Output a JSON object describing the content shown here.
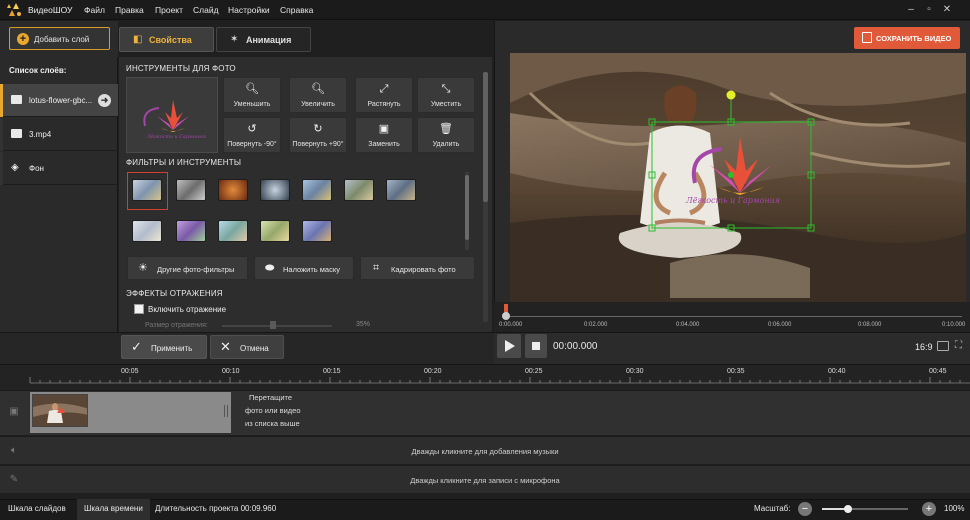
{
  "app": {
    "name": "ВидеоШОУ"
  },
  "menu": [
    "Файл",
    "Правка",
    "Проект",
    "Слайд",
    "Настройки",
    "Справка"
  ],
  "left": {
    "add_layer": "Добавить слой",
    "layers_title": "Список слоёв:"
  },
  "layers": [
    {
      "label": "lotus-flower-gbc...",
      "icon": "image-icon"
    },
    {
      "label": "3.mp4",
      "icon": "video-icon"
    },
    {
      "label": "Фон",
      "icon": "paint-bucket-icon"
    }
  ],
  "tabs": {
    "properties": "Свойства",
    "animation": "Анимация"
  },
  "photo_tools": {
    "title": "ИНСТРУМЕНТЫ ДЛЯ ФОТО",
    "buttons": [
      "Уменьшить",
      "Увеличить",
      "Растянуть",
      "Уместить",
      "Повернуть -90°",
      "Повернуть +90°",
      "Заменить",
      "Удалить"
    ],
    "watermark_text": "Лёгкость и Гармония"
  },
  "filters": {
    "title": "ФИЛЬТРЫ И ИНСТРУМЕНТЫ",
    "more_filters": "Другие фото-фильтры",
    "apply_mask": "Наложить маску",
    "crop_photo": "Кадрировать фото"
  },
  "reflection": {
    "title": "ЭФФЕКТЫ ОТРАЖЕНИЯ",
    "enable": "Включить отражение",
    "size_label": "Размер отражения:",
    "size_value": "35%"
  },
  "actions": {
    "apply": "Применить",
    "cancel": "Отмена"
  },
  "save_button": "СОХРАНИТЬ ВИДЕО",
  "preview_ruler": [
    "0:00.000",
    "0:02.000",
    "0:04.000",
    "0:06.000",
    "0:08.000",
    "0:10.000"
  ],
  "player": {
    "timecode": "00:00.000",
    "aspect": "16:9"
  },
  "timeline": {
    "ticks": [
      "00:05",
      "00:10",
      "00:15",
      "00:20",
      "00:25",
      "00:30",
      "00:35",
      "00:40",
      "00:45"
    ],
    "drop_hint": [
      "Перетащите",
      "фото или видео",
      "из списка выше"
    ],
    "music_hint": "Дважды кликните для добавления музыки",
    "mic_hint": "Дважды кликните для записи с микрофона"
  },
  "status": {
    "slides_tab": "Шкала слайдов",
    "timeline_tab": "Шкала времени",
    "duration": "Длительность проекта 00:09.960",
    "zoom_label": "Масштаб:",
    "zoom_value": "100%",
    "zoom_level": 0.3
  },
  "colors": {
    "accent": "#e9a92e",
    "save": "#e05a3a",
    "selection": "#2dbf2d"
  }
}
